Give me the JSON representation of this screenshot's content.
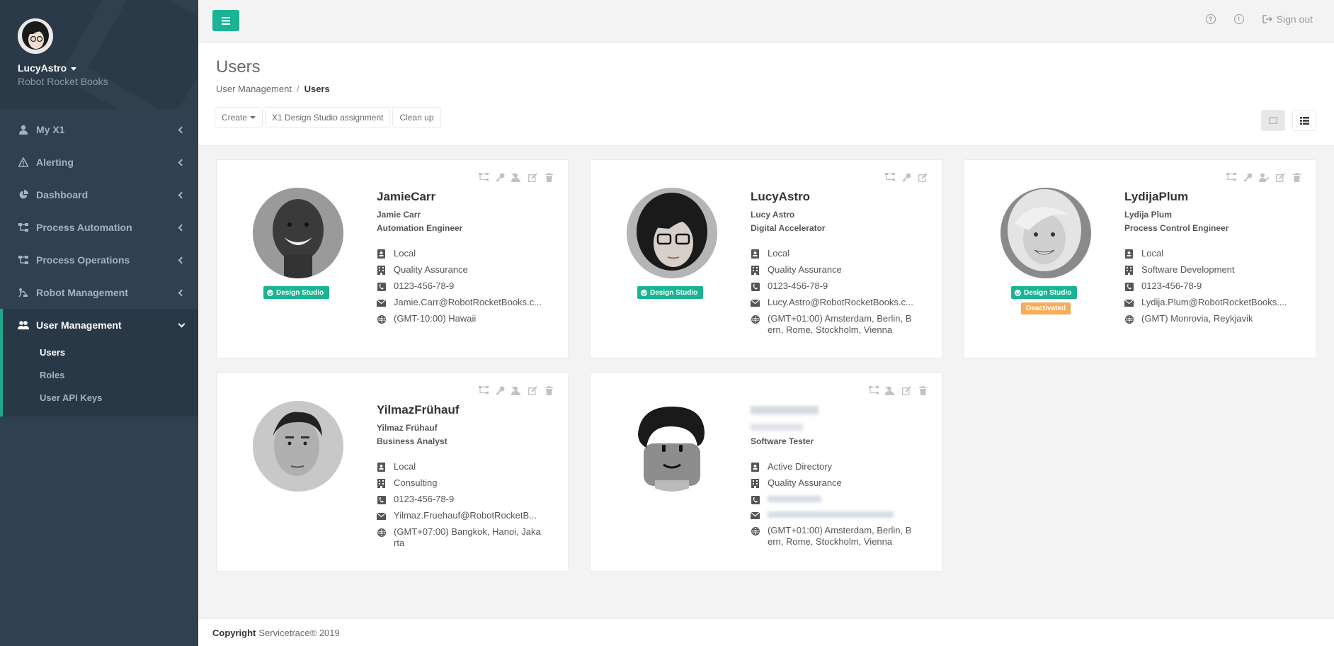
{
  "profile": {
    "name": "LucyAstro",
    "company": "Robot Rocket Books"
  },
  "nav": {
    "items": [
      {
        "label": "My X1",
        "icon": "user-icon"
      },
      {
        "label": "Alerting",
        "icon": "warning-icon"
      },
      {
        "label": "Dashboard",
        "icon": "pie-chart-icon"
      },
      {
        "label": "Process Automation",
        "icon": "sitemap-icon"
      },
      {
        "label": "Process Operations",
        "icon": "sitemap-icon"
      },
      {
        "label": "Robot Management",
        "icon": "robot-icon"
      }
    ],
    "active": {
      "label": "User Management",
      "icon": "users-icon"
    },
    "sub_items": [
      "Users",
      "Roles",
      "User API Keys"
    ]
  },
  "topbar": {
    "sign_out": "Sign out"
  },
  "page": {
    "title": "Users",
    "breadcrumb": [
      "User Management",
      "Users"
    ],
    "toolbar": {
      "create": "Create",
      "assignment": "X1 Design Studio assignment",
      "cleanup": "Clean up"
    }
  },
  "badges": {
    "design_studio": "Design Studio",
    "deactivated": "Deactivated"
  },
  "users": [
    {
      "username": "JamieCarr",
      "fullname": "Jamie Carr",
      "title": "Automation Engineer",
      "auth": "Local",
      "department": "Quality Assurance",
      "phone": "0123-456-78-9",
      "email": "Jamie.Carr@RobotRocketBooks.c...",
      "timezone": "(GMT-10:00) Hawaii",
      "design_studio": true,
      "deactivated": false
    },
    {
      "username": "LucyAstro",
      "fullname": "Lucy Astro",
      "title": "Digital Accelerator",
      "auth": "Local",
      "department": "Quality Assurance",
      "phone": "0123-456-78-9",
      "email": "Lucy.Astro@RobotRocketBooks.c...",
      "timezone": "(GMT+01:00) Amsterdam, Berlin, Bern, Rome, Stockholm, Vienna",
      "design_studio": true,
      "deactivated": false
    },
    {
      "username": "LydijaPlum",
      "fullname": "Lydija Plum",
      "title": "Process Control Engineer",
      "auth": "Local",
      "department": "Software Development",
      "phone": "0123-456-78-9",
      "email": "Lydija.Plum@RobotRocketBooks....",
      "timezone": "(GMT) Monrovia, Reykjavik",
      "design_studio": true,
      "deactivated": true
    },
    {
      "username": "YilmazFrühauf",
      "fullname": "Yilmaz Frühauf",
      "title": "Business Analyst",
      "auth": "Local",
      "department": "Consulting",
      "phone": "0123-456-78-9",
      "email": "Yilmaz.Fruehauf@RobotRocketB...",
      "timezone": "(GMT+07:00) Bangkok, Hanoi, Jakarta",
      "design_studio": false,
      "deactivated": false
    },
    {
      "username": "",
      "fullname": "",
      "title": "Software Tester",
      "auth": "Active Directory",
      "department": "Quality Assurance",
      "phone": "",
      "email": "",
      "timezone": "(GMT+01:00) Amsterdam, Berlin, Bern, Rome, Stockholm, Vienna",
      "design_studio": false,
      "deactivated": false
    }
  ],
  "footer": {
    "label": "Copyright",
    "text": "Servicetrace® 2019"
  },
  "colors": {
    "sidebar": "#2f4050",
    "accent": "#1ab394",
    "warning": "#f8ac59"
  }
}
